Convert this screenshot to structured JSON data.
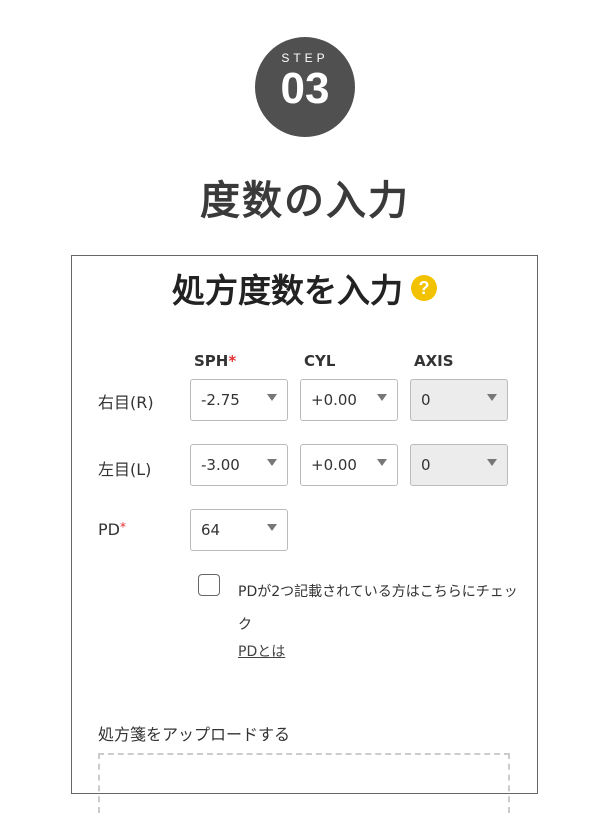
{
  "step": {
    "word": "STEP",
    "number": "03"
  },
  "heading": "度数の入力",
  "card": {
    "title": "処方度数を入力",
    "help_icon": "?",
    "columns": {
      "sph": "SPH",
      "cyl": "CYL",
      "axis": "AXIS",
      "required_mark": "*"
    },
    "right_eye": {
      "label": "右目(R)",
      "sph": "-2.75",
      "cyl": "+0.00",
      "axis": "0"
    },
    "left_eye": {
      "label": "左目(L)",
      "sph": "-3.00",
      "cyl": "+0.00",
      "axis": "0"
    },
    "pd": {
      "label": "PD",
      "required_mark": "*",
      "value": "64"
    },
    "pd_two_checkbox_label": "PDが2つ記載されている方はこちらにチェック",
    "pd_link": "PDとは",
    "upload_label": "処方箋をアップロードする"
  },
  "colors": {
    "badge": "#505050",
    "help_icon": "#f2c200",
    "required": "#e03030"
  }
}
